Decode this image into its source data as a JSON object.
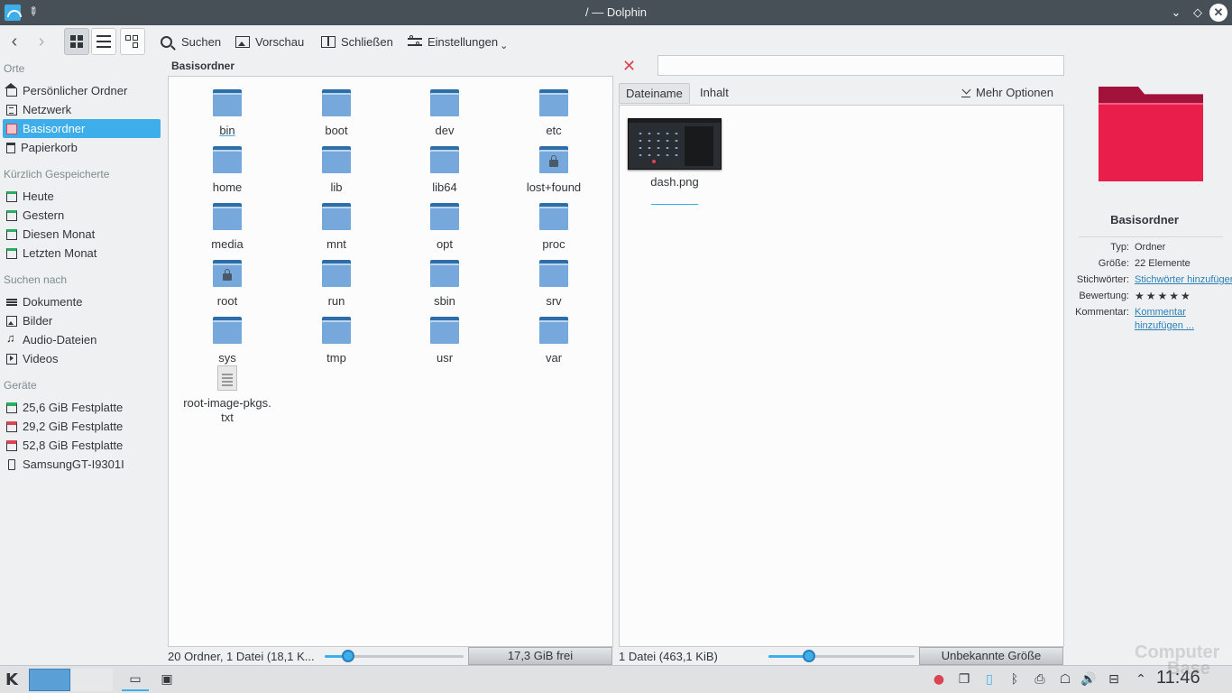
{
  "window": {
    "title": "/ — Dolphin"
  },
  "toolbar": {
    "search_label": "Suchen",
    "preview_label": "Vorschau",
    "close_label": "Schließen",
    "settings_label": "Einstellungen"
  },
  "places": {
    "section_places": "Orte",
    "items_places": [
      "Persönlicher Ordner",
      "Netzwerk",
      "Basisordner",
      "Papierkorb"
    ],
    "section_recent": "Kürzlich Gespeicherte",
    "items_recent": [
      "Heute",
      "Gestern",
      "Diesen Monat",
      "Letzten Monat"
    ],
    "section_search": "Suchen nach",
    "items_search": [
      "Dokumente",
      "Bilder",
      "Audio-Dateien",
      "Videos"
    ],
    "section_devices": "Geräte",
    "items_devices": [
      "25,6 GiB Festplatte",
      "29,2 GiB Festplatte",
      "52,8 GiB Festplatte",
      "SamsungGT-I9301I"
    ]
  },
  "left_pane": {
    "title": "Basisordner",
    "folders": [
      "bin",
      "boot",
      "dev",
      "etc",
      "home",
      "lib",
      "lib64",
      "lost+found",
      "media",
      "mnt",
      "opt",
      "proc",
      "root",
      "run",
      "sbin",
      "srv",
      "sys",
      "tmp",
      "usr",
      "var"
    ],
    "file": "root-image-pkgs.txt",
    "file_line1": "root-image-pkgs.",
    "file_line2": "txt",
    "status": "20 Ordner, 1 Datei (18,1 K...",
    "free_space": "17,3 GiB frei",
    "zoom_level": 0.17
  },
  "right_pane": {
    "filter_placeholder": "",
    "tab_filename": "Dateiname",
    "tab_content": "Inhalt",
    "more_options": "Mehr Optionen",
    "file": "dash.png",
    "status": "1 Datei (463,1 KiB)",
    "free_space": "Unbekannte Größe",
    "zoom_level": 0.28
  },
  "info": {
    "title": "Basisordner",
    "type_key": "Typ:",
    "type_val": "Ordner",
    "size_key": "Größe:",
    "size_val": "22 Elemente",
    "tags_key": "Stichwörter:",
    "tags_val": "Stichwörter hinzufügen",
    "rating_key": "Bewertung:",
    "rating_val": "★★★★★",
    "comment_key": "Kommentar:",
    "comment_val1": "Kommentar",
    "comment_val2": "hinzufügen ..."
  },
  "taskbar": {
    "clock": "11:46",
    "watermark_line1": "Computer",
    "watermark_line2": "Base"
  },
  "colors": {
    "accent": "#3daee9",
    "titlebar": "#475057",
    "folder": "#76a8db",
    "info_folder": "#e91e4a"
  }
}
